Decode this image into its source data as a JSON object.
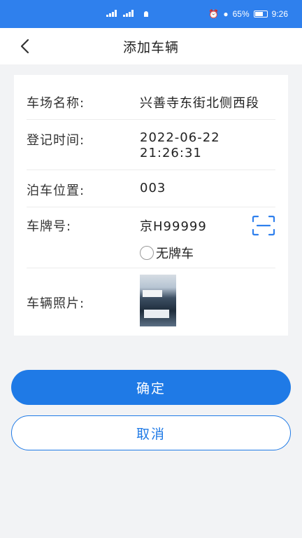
{
  "status_bar": {
    "battery": "65%",
    "time": "9:26"
  },
  "header": {
    "title": "添加车辆"
  },
  "form": {
    "parking_lot": {
      "label": "车场名称:",
      "value": "兴善寺东街北侧西段"
    },
    "register_time": {
      "label": "登记时间:",
      "date": "2022-06-22",
      "time": "21:26:31"
    },
    "parking_spot": {
      "label": "泊车位置:",
      "value": "003"
    },
    "plate": {
      "label": "车牌号:",
      "value": "京H99999",
      "no_plate_option": "无牌车"
    },
    "photo": {
      "label": "车辆照片:"
    }
  },
  "actions": {
    "confirm": "确定",
    "cancel": "取消"
  },
  "colors": {
    "accent": "#1f7ae6",
    "status_bar": "#2f80ed"
  },
  "icons": [
    "back-icon",
    "scan-icon",
    "battery-icon",
    "signal-icon"
  ]
}
